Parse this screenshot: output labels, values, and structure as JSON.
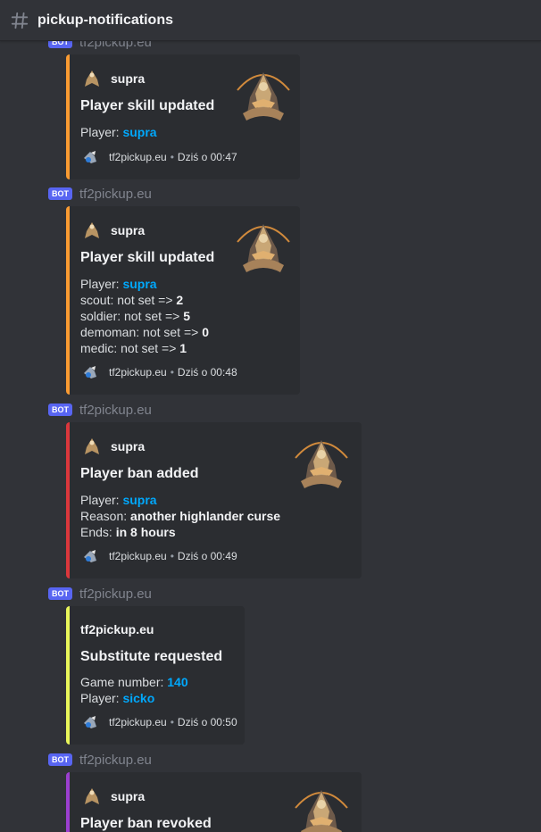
{
  "channel": {
    "name": "pickup-notifications",
    "icon": "hash-icon"
  },
  "bot_tag": "BOT",
  "messages": [
    {
      "author": "tf2pickup.eu",
      "embed": {
        "color": "#f99b32",
        "author_name": "supra",
        "title": "Player skill updated",
        "player_label": "Player:",
        "player": "supra",
        "footer_name": "tf2pickup.eu",
        "footer_time": "Dziś o 00:47"
      }
    },
    {
      "author": "tf2pickup.eu",
      "embed": {
        "color": "#f99b32",
        "author_name": "supra",
        "title": "Player skill updated",
        "player_label": "Player:",
        "player": "supra",
        "skills": [
          {
            "label": "scout: not set =>",
            "value": "2"
          },
          {
            "label": "soldier: not set =>",
            "value": "5"
          },
          {
            "label": "demoman: not set =>",
            "value": "0"
          },
          {
            "label": "medic: not set =>",
            "value": "1"
          }
        ],
        "footer_name": "tf2pickup.eu",
        "footer_time": "Dziś o 00:48"
      }
    },
    {
      "author": "tf2pickup.eu",
      "embed": {
        "color": "#da373c",
        "author_name": "supra",
        "title": "Player ban added",
        "player_label": "Player:",
        "player": "supra",
        "reason_label": "Reason:",
        "reason": "another highlander curse",
        "ends_label": "Ends:",
        "ends": "in 8 hours",
        "footer_name": "tf2pickup.eu",
        "footer_time": "Dziś o 00:49"
      }
    },
    {
      "author": "tf2pickup.eu",
      "embed": {
        "color": "#e8f55a",
        "author_name": "tf2pickup.eu",
        "title": "Substitute requested",
        "game_label": "Game number:",
        "game": "140",
        "player_label": "Player:",
        "player": "sicko",
        "footer_name": "tf2pickup.eu",
        "footer_time": "Dziś o 00:50"
      }
    },
    {
      "author": "tf2pickup.eu",
      "embed": {
        "color": "#9b3fcf",
        "author_name": "supra",
        "title": "Player ban revoked"
      }
    }
  ],
  "footer_separator": "•"
}
